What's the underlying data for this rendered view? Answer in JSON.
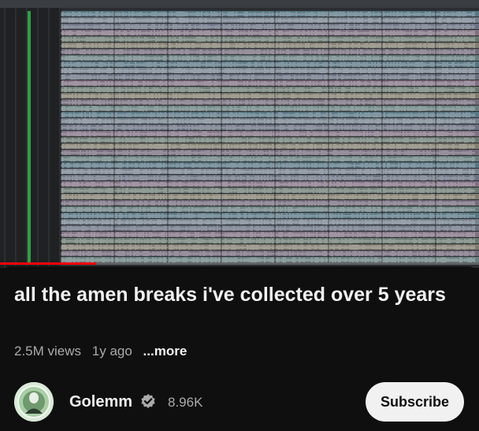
{
  "video": {
    "progress_fraction": 0.2,
    "accent_color": "#ff0000",
    "track_colors": [
      "#7fb2c6",
      "#b6c9d9",
      "#9fa9c2",
      "#c8a9c6",
      "#a1b9a5",
      "#c9bfa2",
      "#b3a0b8",
      "#9cc3c0"
    ],
    "playhead_color": "#2ea043"
  },
  "meta_info": {
    "title": "all the amen breaks i've collected over 5 years",
    "views": "2.5M views",
    "age": "1y ago",
    "more_label": "...more"
  },
  "channel": {
    "name": "Golemm",
    "subscribers": "8.96K",
    "subscribe_label": "Subscribe",
    "verified_icon": "verified-check-icon",
    "avatar_icon": "channel-avatar"
  }
}
